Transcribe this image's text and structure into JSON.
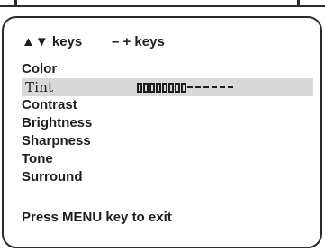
{
  "osd": {
    "keys_hint": {
      "navigate": "▲▼ keys",
      "adjust": "– + keys"
    },
    "menu_items": [
      {
        "label": "Color"
      },
      {
        "label": "Tint",
        "selected": true,
        "level": {
          "filled": 8,
          "empty": 6,
          "total": 14
        }
      },
      {
        "label": "Contrast"
      },
      {
        "label": "Brightness"
      },
      {
        "label": "Sharpness"
      },
      {
        "label": "Tone"
      },
      {
        "label": "Surround"
      }
    ],
    "exit_hint": "Press MENU key to exit",
    "colors": {
      "highlight": "#d9d9d9",
      "text": "#1e1e1e",
      "border": "#2a2a2a"
    }
  }
}
